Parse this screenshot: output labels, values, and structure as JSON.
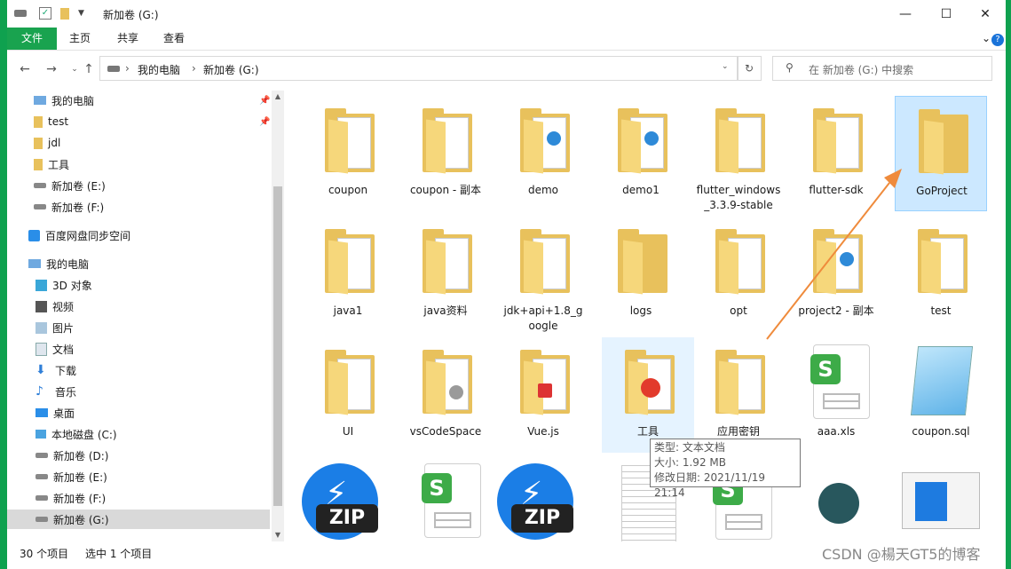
{
  "window": {
    "title": "新加卷 (G:)",
    "controls": {
      "minimize": "—",
      "maximize": "☐",
      "close": "✕"
    }
  },
  "ribbon": {
    "tabs": [
      "文件",
      "主页",
      "共享",
      "查看"
    ],
    "help": "?"
  },
  "address": {
    "crumbs": [
      "我的电脑",
      "新加卷 (G:)"
    ],
    "search_placeholder": "在 新加卷 (G:) 中搜索"
  },
  "nav": {
    "items": [
      {
        "label": "我的电脑",
        "icon": "computer-icon",
        "pinned": true
      },
      {
        "label": "test",
        "icon": "folder-icon",
        "pinned": true
      },
      {
        "label": "jdl",
        "icon": "folder-icon",
        "pinned": false
      },
      {
        "label": "工具",
        "icon": "folder-icon",
        "pinned": false
      },
      {
        "label": "新加卷 (E:)",
        "icon": "drive-icon",
        "pinned": false
      },
      {
        "label": "新加卷 (F:)",
        "icon": "drive-icon",
        "pinned": false
      },
      {
        "label": "百度网盘同步空间",
        "icon": "baidu-icon",
        "pinned": false
      },
      {
        "label": "我的电脑",
        "icon": "computer-icon",
        "pinned": false
      },
      {
        "label": "3D 对象",
        "icon": "3d-objects-icon",
        "pinned": false
      },
      {
        "label": "视频",
        "icon": "video-icon",
        "pinned": false
      },
      {
        "label": "图片",
        "icon": "pictures-icon",
        "pinned": false
      },
      {
        "label": "文档",
        "icon": "documents-icon",
        "pinned": false
      },
      {
        "label": "下载",
        "icon": "download-icon",
        "pinned": false
      },
      {
        "label": "音乐",
        "icon": "music-icon",
        "pinned": false
      },
      {
        "label": "桌面",
        "icon": "desktop-icon",
        "pinned": false
      },
      {
        "label": "本地磁盘 (C:)",
        "icon": "windows-drive-icon",
        "pinned": false
      },
      {
        "label": "新加卷 (D:)",
        "icon": "drive-icon",
        "pinned": false
      },
      {
        "label": "新加卷 (E:)",
        "icon": "drive-icon",
        "pinned": false
      },
      {
        "label": "新加卷 (F:)",
        "icon": "drive-icon",
        "pinned": false
      },
      {
        "label": "新加卷 (G:)",
        "icon": "drive-icon",
        "pinned": false,
        "selected": true
      }
    ]
  },
  "files": [
    {
      "name": "coupon",
      "type": "folder-doc"
    },
    {
      "name": "coupon - 副本",
      "type": "folder-doc"
    },
    {
      "name": "demo",
      "type": "folder-globe"
    },
    {
      "name": "demo1",
      "type": "folder-globe"
    },
    {
      "name": "flutter_windows_3.3.9-stable",
      "type": "folder-doc"
    },
    {
      "name": "flutter-sdk",
      "type": "folder-doc"
    },
    {
      "name": "GoProject",
      "type": "folder",
      "selected": true
    },
    {
      "name": "java1",
      "type": "folder-doc"
    },
    {
      "name": "java资料",
      "type": "folder-doc"
    },
    {
      "name": "jdk+api+1.8_google",
      "type": "folder-doc"
    },
    {
      "name": "logs",
      "type": "folder"
    },
    {
      "name": "opt",
      "type": "folder-doc"
    },
    {
      "name": "project2 - 副本",
      "type": "folder-globe"
    },
    {
      "name": "test",
      "type": "folder-doc"
    },
    {
      "name": "UI",
      "type": "folder-doc"
    },
    {
      "name": "vsCodeSpace",
      "type": "folder-doc"
    },
    {
      "name": "Vue.js",
      "type": "folder-doc"
    },
    {
      "name": "工具",
      "type": "folder-app",
      "hovered": true
    },
    {
      "name": "应用密钥",
      "type": "folder-doc"
    },
    {
      "name": "aaa.xls",
      "type": "sheet"
    },
    {
      "name": "coupon.sql",
      "type": "notepad"
    }
  ],
  "tooltip": {
    "type": "类型: 文本文档",
    "size": "大小: 1.92 MB",
    "modified": "修改日期: 2021/11/19 21:14"
  },
  "status": {
    "count": "30 个项目",
    "selected": "选中 1 个项目"
  },
  "watermark": "CSDN @楊天GT5的博客",
  "colors": {
    "accent": "#19a34f",
    "selection": "#cce8ff",
    "folder": "#e8c15c"
  }
}
